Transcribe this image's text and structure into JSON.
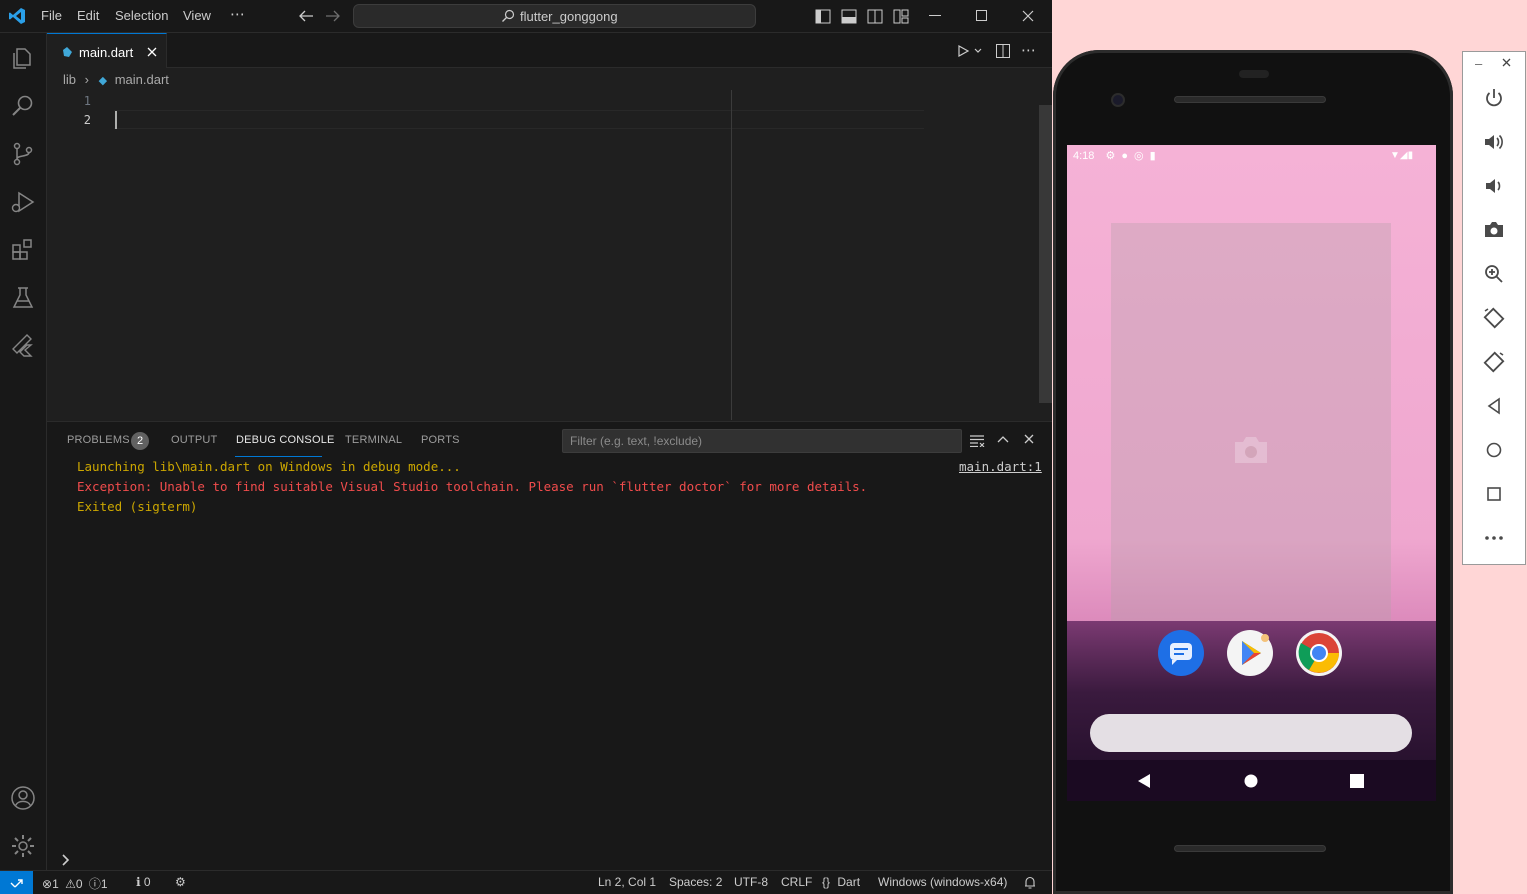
{
  "titlebar": {
    "menu": [
      "File",
      "Edit",
      "Selection",
      "View",
      "⋯"
    ],
    "search_text": "flutter_gonggong",
    "window_controls": [
      "minimize-icon",
      "maximize-icon",
      "close-icon"
    ]
  },
  "activitybar": {
    "items": [
      "explorer-icon",
      "search-icon",
      "source-control-icon",
      "run-debug-icon",
      "extensions-icon",
      "testing-icon",
      "flutter-icon"
    ],
    "bottom": [
      "account-icon",
      "settings-gear-icon"
    ]
  },
  "editor": {
    "tab_label": "main.dart",
    "breadcrumb": [
      "lib",
      "main.dart"
    ],
    "line_numbers": [
      "1",
      "2"
    ]
  },
  "panel": {
    "tabs": [
      "PROBLEMS",
      "OUTPUT",
      "DEBUG CONSOLE",
      "TERMINAL",
      "PORTS"
    ],
    "problems_count": "2",
    "active_tab": "DEBUG CONSOLE",
    "filter_placeholder": "Filter (e.g. text, !exclude)",
    "console": [
      {
        "text": "Launching lib\\main.dart on Windows in debug mode...",
        "color": "#cca700"
      },
      {
        "text": "Exception: Unable to find suitable Visual Studio toolchain. Please run `flutter doctor` for more details.",
        "color": "#f14c4c"
      },
      {
        "text": "Exited (sigterm)",
        "color": "#cca700"
      }
    ],
    "source_link": "main.dart:1",
    "prompt": ">"
  },
  "statusbar": {
    "errors": "1",
    "warnings": "0",
    "info": "1",
    "ports": "0",
    "position": "Ln 2, Col 1",
    "spaces": "Spaces: 2",
    "encoding": "UTF-8",
    "eol": "CRLF",
    "language": "Dart",
    "device": "Windows (windows-x64)"
  },
  "emulator": {
    "time": "4:18",
    "toolbar": [
      "power-icon",
      "volume-up-icon",
      "volume-down-icon",
      "camera-icon",
      "zoom-icon",
      "rotate-left-icon",
      "rotate-right-icon",
      "back-icon",
      "home-icon",
      "overview-icon",
      "more-icon"
    ],
    "dock_apps": [
      "messages-icon",
      "play-store-icon",
      "chrome-icon"
    ]
  },
  "colors": {
    "accent": "#0078d4",
    "warning": "#cca700",
    "error": "#f14c4c"
  }
}
